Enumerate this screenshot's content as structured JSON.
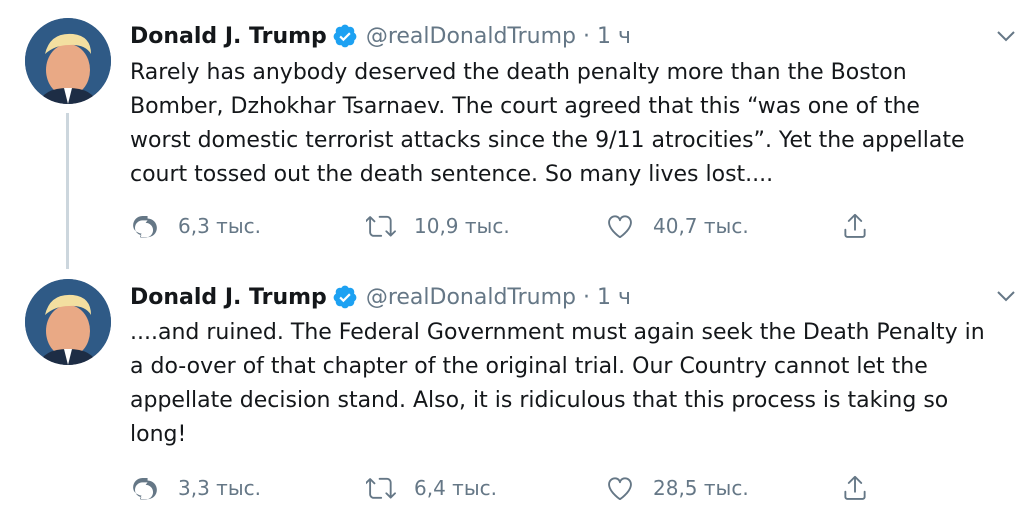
{
  "colors": {
    "text": "#14171a",
    "secondary": "#657786",
    "verified": "#1da1f2",
    "thread_line": "#ccd6dd"
  },
  "tweets": [
    {
      "author_name": "Donald J. Trump",
      "handle": "@realDonaldTrump",
      "separator": "·",
      "time": "1 ч",
      "text_lines": [
        "Rarely has anybody deserved the death penalty more than the Boston",
        "Bomber, Dzhokhar Tsarnaev. The court agreed that this “was one of the",
        "worst domestic terrorist attacks since the 9/11 atrocities”. Yet the appellate",
        "court tossed out the death sentence. So many lives lost...."
      ],
      "replies": "6,3 тыс.",
      "retweets": "10,9 тыс.",
      "likes": "40,7 тыс.",
      "icons": [
        "verified-badge-icon",
        "chevron-down-icon",
        "reply-icon",
        "retweet-icon",
        "heart-icon",
        "share-icon"
      ]
    },
    {
      "author_name": "Donald J. Trump",
      "handle": "@realDonaldTrump",
      "separator": "·",
      "time": "1 ч",
      "text_lines": [
        "....and ruined. The Federal Government must again seek the Death Penalty in",
        "a do-over of that chapter of the original trial. Our Country cannot let the",
        "appellate decision stand. Also, it is ridiculous that this process is taking so",
        "long!"
      ],
      "replies": "3,3 тыс.",
      "retweets": "6,4 тыс.",
      "likes": "28,5 тыс.",
      "icons": [
        "verified-badge-icon",
        "chevron-down-icon",
        "reply-icon",
        "retweet-icon",
        "heart-icon",
        "share-icon"
      ]
    }
  ]
}
